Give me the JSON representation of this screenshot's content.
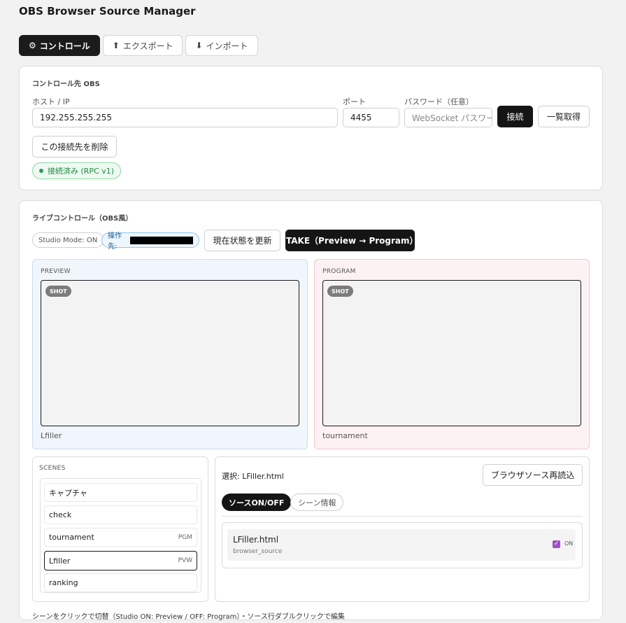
{
  "app": {
    "title": "OBS Browser Source Manager"
  },
  "tabs": [
    {
      "icon": "⚙",
      "label": "コントロール"
    },
    {
      "icon": "⬆",
      "label": "エクスポート"
    },
    {
      "icon": "⬇",
      "label": "インポート"
    }
  ],
  "target": {
    "section_title": "コントロール先 OBS",
    "host_label": "ホスト / IP",
    "host_value": "192.255.255.255",
    "port_label": "ポート",
    "port_value": "4455",
    "password_label": "パスワード（任意）",
    "password_placeholder": "WebSocket パスワード",
    "connect_label": "接続",
    "list_label": "一覧取得",
    "delete_label": "この接続先を削除",
    "status_text": "接続済み (RPC v1)"
  },
  "live": {
    "section_title": "ライブコントロール（OBS風）",
    "studio_mode": "Studio Mode: ON",
    "operator_label": "操作先:",
    "refresh_label": "現在状態を更新",
    "take_label": "TAKE（Preview → Program）",
    "preview": {
      "label": "PREVIEW",
      "shot": "SHOT",
      "scene": "Lfiller"
    },
    "program": {
      "label": "PROGRAM",
      "shot": "SHOT",
      "scene": "tournament"
    }
  },
  "scenes": {
    "title": "SCENES",
    "items": [
      {
        "name": "キャプチャ",
        "tag": ""
      },
      {
        "name": "check",
        "tag": ""
      },
      {
        "name": "tournament",
        "tag": "PGM"
      },
      {
        "name": "Lfiller",
        "tag": "PVW"
      },
      {
        "name": "ranking",
        "tag": ""
      }
    ]
  },
  "detail": {
    "selected": "選択: LFiller.html",
    "reload_label": "ブラウザソース再読込",
    "subtabs": [
      "ソースON/OFF",
      "シーン情報"
    ],
    "source": {
      "name": "LFiller.html",
      "kind": "browser_source",
      "state": "ON"
    }
  },
  "hint": "シーンをクリックで切替（Studio ON: Preview / OFF: Program）・ソース行ダブルクリックで編集",
  "colors": {
    "accent_dark": "#151515",
    "connected_green": "#1f8a45",
    "checkbox_purple": "#a04fc4",
    "preview_bg": "#f1f6fd",
    "program_bg": "#fdf2f3"
  }
}
